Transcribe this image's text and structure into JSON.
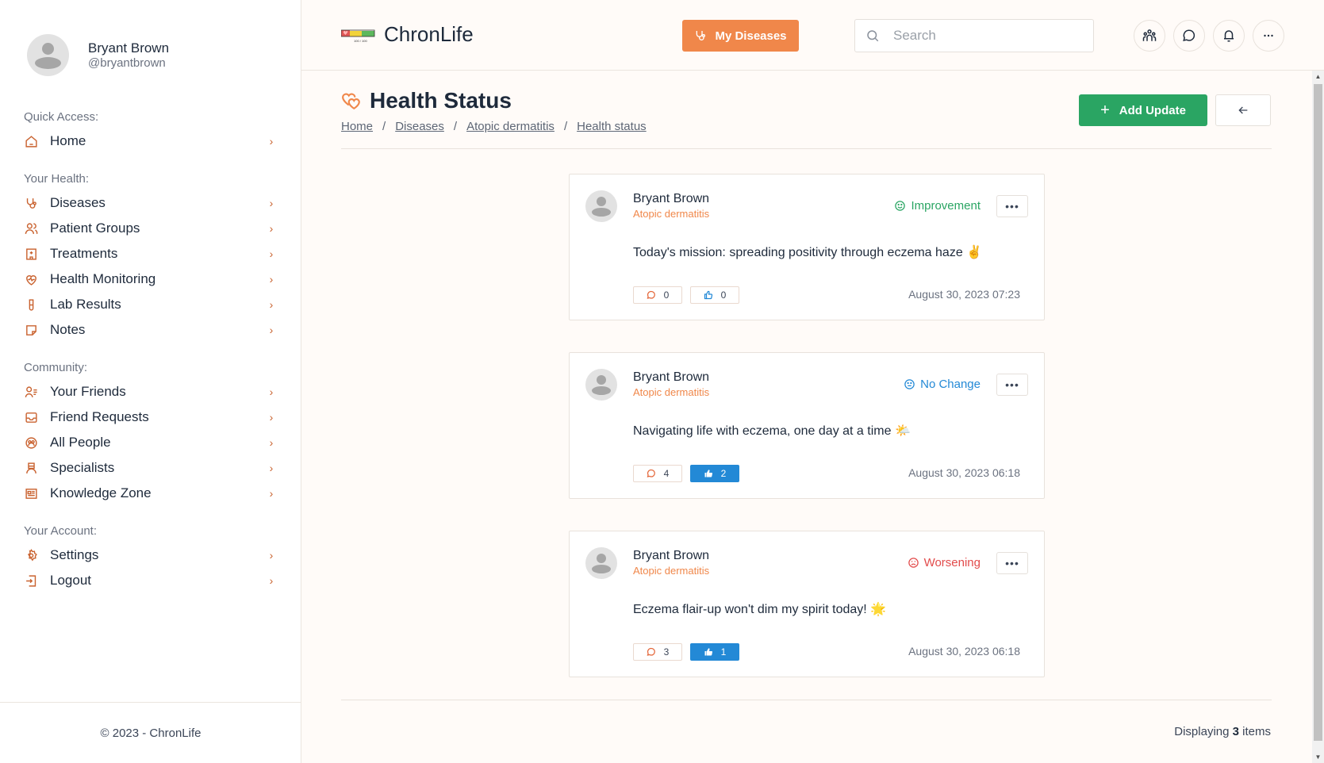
{
  "profile": {
    "name": "Bryant Brown",
    "handle": "@bryantbrown"
  },
  "sidebar": {
    "sections": [
      {
        "title": "Quick Access:",
        "items": [
          {
            "label": "Home",
            "icon": "home-icon"
          }
        ]
      },
      {
        "title": "Your Health:",
        "items": [
          {
            "label": "Diseases",
            "icon": "stethoscope-icon"
          },
          {
            "label": "Patient Groups",
            "icon": "users-icon"
          },
          {
            "label": "Treatments",
            "icon": "hospital-icon"
          },
          {
            "label": "Health Monitoring",
            "icon": "heart-pulse-icon"
          },
          {
            "label": "Lab Results",
            "icon": "test-tube-icon"
          },
          {
            "label": "Notes",
            "icon": "note-icon"
          }
        ]
      },
      {
        "title": "Community:",
        "items": [
          {
            "label": "Your Friends",
            "icon": "user-list-icon"
          },
          {
            "label": "Friend Requests",
            "icon": "inbox-icon"
          },
          {
            "label": "All People",
            "icon": "people-circle-icon"
          },
          {
            "label": "Specialists",
            "icon": "doctor-icon"
          },
          {
            "label": "Knowledge Zone",
            "icon": "newspaper-icon"
          }
        ]
      },
      {
        "title": "Your Account:",
        "items": [
          {
            "label": "Settings",
            "icon": "gear-icon"
          },
          {
            "label": "Logout",
            "icon": "logout-icon"
          }
        ]
      }
    ],
    "footer": "© 2023 - ChronLife"
  },
  "header": {
    "app_name": "ChronLife",
    "logo_caption": "100 / 100",
    "my_diseases_label": "My Diseases",
    "search_placeholder": "Search",
    "search_value": ""
  },
  "page": {
    "title": "Health Status",
    "breadcrumb": [
      "Home",
      "Diseases",
      "Atopic dermatitis",
      "Health status"
    ],
    "add_update_label": "Add Update",
    "displaying_prefix": "Displaying",
    "displaying_count": "3",
    "displaying_suffix": "items"
  },
  "colors": {
    "accent": "#f0874a",
    "primary_green": "#2aa563",
    "like_blue": "#2389d6",
    "improvement": "#2aa563",
    "no_change": "#2389d6",
    "worsening": "#e24b4b"
  },
  "posts": [
    {
      "author": "Bryant Brown",
      "disease": "Atopic dermatitis",
      "status": "Improvement",
      "status_type": "improvement",
      "text": "Today's mission: spreading positivity through eczema haze ✌️",
      "comments": "0",
      "likes": "0",
      "liked": false,
      "date": "August 30, 2023 07:23"
    },
    {
      "author": "Bryant Brown",
      "disease": "Atopic dermatitis",
      "status": "No Change",
      "status_type": "no_change",
      "text": "Navigating life with eczema, one day at a time 🌤️",
      "comments": "4",
      "likes": "2",
      "liked": true,
      "date": "August 30, 2023 06:18"
    },
    {
      "author": "Bryant Brown",
      "disease": "Atopic dermatitis",
      "status": "Worsening",
      "status_type": "worsening",
      "text": "Eczema flair-up won't dim my spirit today! 🌟",
      "comments": "3",
      "likes": "1",
      "liked": true,
      "date": "August 30, 2023 06:18"
    }
  ]
}
